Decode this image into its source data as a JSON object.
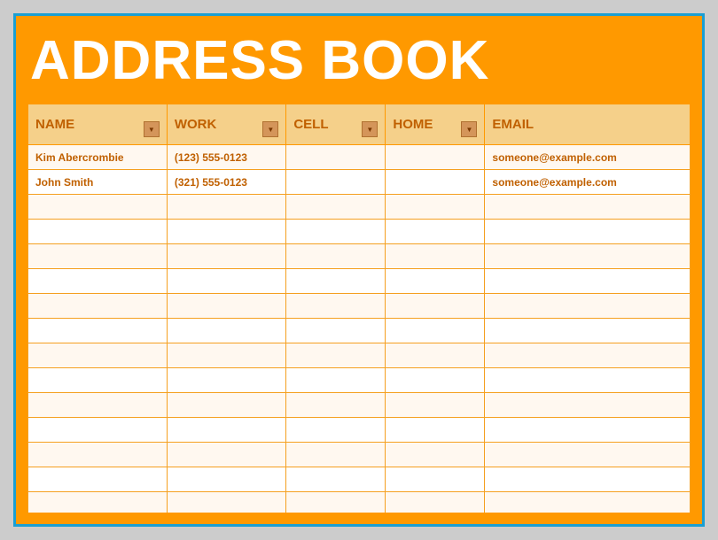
{
  "title": "ADDRESS BOOK",
  "colors": {
    "orange": "#f90",
    "header_bg": "#f5d08a",
    "header_text": "#c06000",
    "border": "#f5a020",
    "teal_border": "#1a9fd4"
  },
  "columns": [
    {
      "id": "name",
      "label": "NAME",
      "class": "col-name",
      "has_dropdown": true
    },
    {
      "id": "work",
      "label": "WORK",
      "class": "col-work",
      "has_dropdown": true
    },
    {
      "id": "cell",
      "label": "CELL",
      "class": "col-cell",
      "has_dropdown": true
    },
    {
      "id": "home",
      "label": "HOME",
      "class": "col-home",
      "has_dropdown": true
    },
    {
      "id": "email",
      "label": "EMAIL",
      "class": "col-email",
      "has_dropdown": false
    }
  ],
  "rows": [
    {
      "name": "Kim Abercrombie",
      "work": "(123) 555-0123",
      "cell": "",
      "home": "",
      "email": "someone@example.com"
    },
    {
      "name": "John Smith",
      "work": "(321) 555-0123",
      "cell": "",
      "home": "",
      "email": "someone@example.com"
    },
    {
      "name": "",
      "work": "",
      "cell": "",
      "home": "",
      "email": ""
    },
    {
      "name": "",
      "work": "",
      "cell": "",
      "home": "",
      "email": ""
    },
    {
      "name": "",
      "work": "",
      "cell": "",
      "home": "",
      "email": ""
    },
    {
      "name": "",
      "work": "",
      "cell": "",
      "home": "",
      "email": ""
    },
    {
      "name": "",
      "work": "",
      "cell": "",
      "home": "",
      "email": ""
    },
    {
      "name": "",
      "work": "",
      "cell": "",
      "home": "",
      "email": ""
    },
    {
      "name": "",
      "work": "",
      "cell": "",
      "home": "",
      "email": ""
    },
    {
      "name": "",
      "work": "",
      "cell": "",
      "home": "",
      "email": ""
    },
    {
      "name": "",
      "work": "",
      "cell": "",
      "home": "",
      "email": ""
    },
    {
      "name": "",
      "work": "",
      "cell": "",
      "home": "",
      "email": ""
    },
    {
      "name": "",
      "work": "",
      "cell": "",
      "home": "",
      "email": ""
    },
    {
      "name": "",
      "work": "",
      "cell": "",
      "home": "",
      "email": ""
    },
    {
      "name": "",
      "work": "",
      "cell": "",
      "home": "",
      "email": ""
    },
    {
      "name": "",
      "work": "",
      "cell": "",
      "home": "",
      "email": ""
    }
  ]
}
